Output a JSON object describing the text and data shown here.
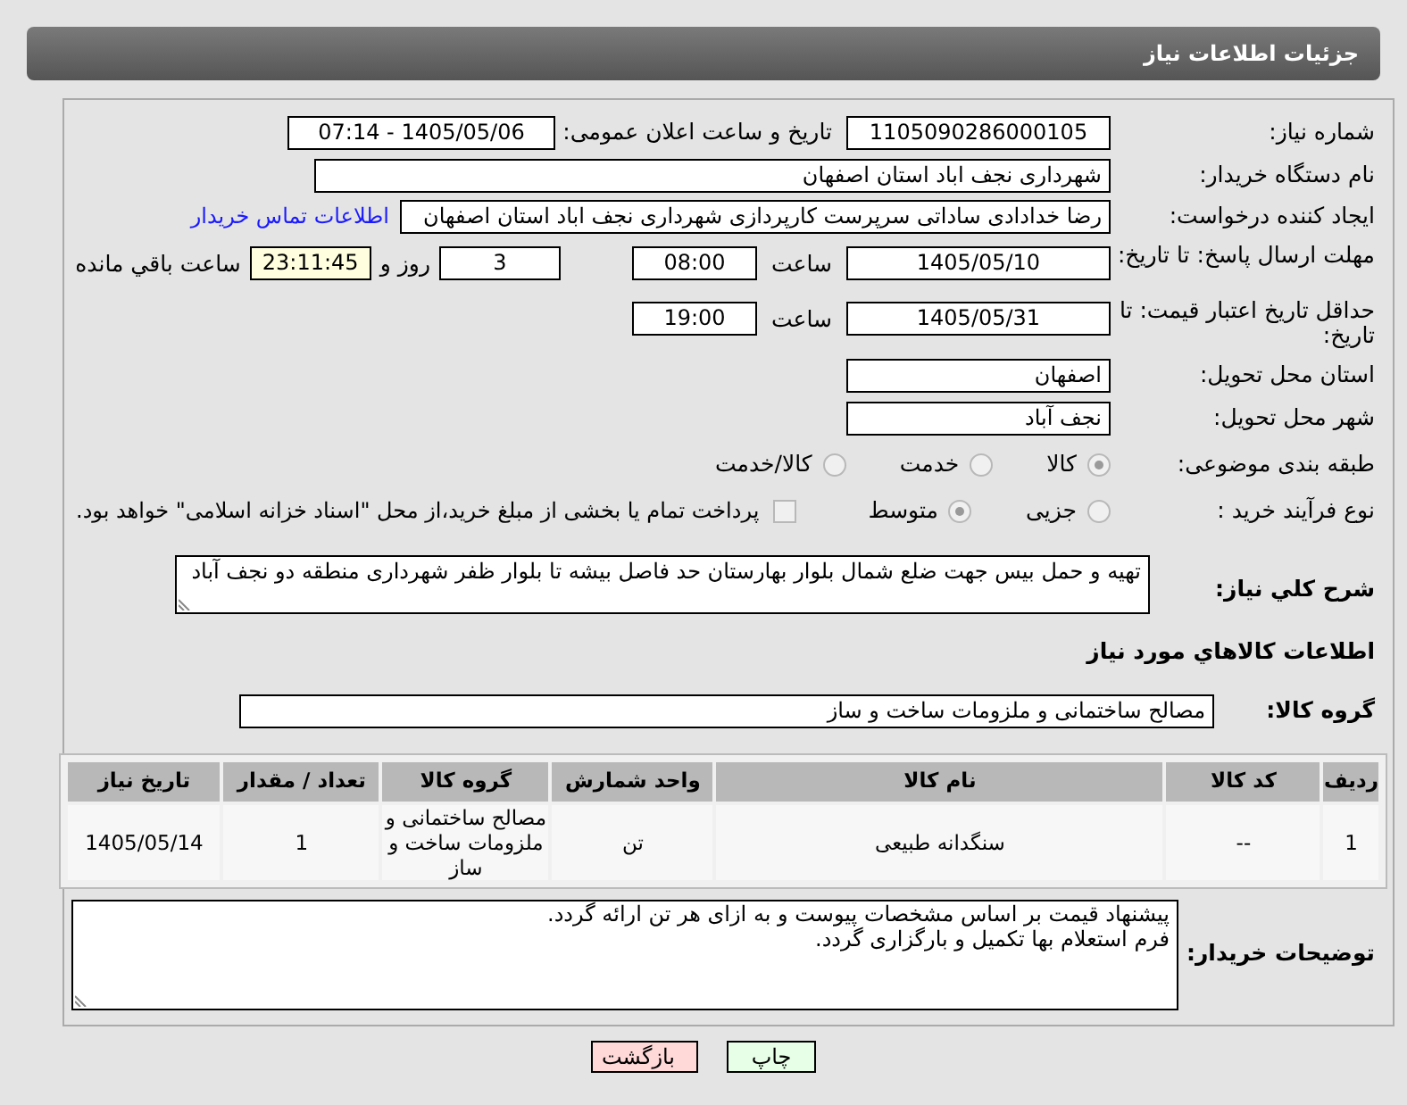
{
  "header": {
    "title": "جزئیات اطلاعات نیاز"
  },
  "need_number": {
    "label": "شماره نیاز:",
    "value": "1105090286000105"
  },
  "announce_datetime": {
    "label": "تاریخ و ساعت اعلان عمومی:",
    "value": "1405/05/06 - 07:14"
  },
  "buyer_org": {
    "label": "نام دستگاه خریدار:",
    "value": "شهرداری نجف اباد استان اصفهان"
  },
  "requester": {
    "label": "ایجاد کننده درخواست:",
    "value": "رضا خدادادی ساداتی سرپرست  کارپردازی شهرداری نجف اباد استان اصفهان",
    "link": "اطلاعات تماس خریدار"
  },
  "reply_deadline": {
    "label": "مهلت ارسال پاسخ: تا تاریخ:",
    "date": "1405/05/10",
    "time_label": "ساعت",
    "time": "08:00",
    "days": "3",
    "days_label": "روز و",
    "remaining": "23:11:45",
    "remaining_label": "ساعت باقي مانده"
  },
  "price_validity": {
    "label": "حداقل تاریخ اعتبار قیمت: تا تاریخ:",
    "date": "1405/05/31",
    "time_label": "ساعت",
    "time": "19:00"
  },
  "delivery_province": {
    "label": "استان محل تحویل:",
    "value": "اصفهان"
  },
  "delivery_city": {
    "label": "شهر محل تحویل:",
    "value": "نجف آباد"
  },
  "category": {
    "label": "طبقه بندی موضوعی:",
    "options": [
      {
        "label": "کالا",
        "selected": true
      },
      {
        "label": "خدمت",
        "selected": false
      },
      {
        "label": "کالا/خدمت",
        "selected": false
      }
    ]
  },
  "process": {
    "label": "نوع فرآیند خرید :",
    "options": [
      {
        "label": "جزیی",
        "selected": false
      },
      {
        "label": "متوسط",
        "selected": true
      }
    ],
    "treasury": {
      "label": "پرداخت تمام یا بخشی از مبلغ خرید،از محل \"اسناد خزانه اسلامی\" خواهد بود.",
      "checked": false
    }
  },
  "description": {
    "label": "شرح کلي نياز:",
    "value": "تهیه و حمل بیس جهت ضلع شمال بلوار بهارستان حد فاصل بیشه تا بلوار ظفر شهرداری منطقه دو نجف آباد"
  },
  "goods_section": {
    "title": "اطلاعات کالاهاي مورد نياز"
  },
  "goods_group": {
    "label": "گروه کالا:",
    "value": "مصالح ساختمانی و ملزومات ساخت و ساز"
  },
  "table": {
    "columns": [
      "ردیف",
      "کد کالا",
      "نام کالا",
      "واحد شمارش",
      "گروه کالا",
      "تعداد / مقدار",
      "تاریخ نیاز"
    ],
    "rows": [
      [
        "1",
        "--",
        "سنگدانه طبیعی",
        "تن",
        "مصالح ساختمانی و ملزومات ساخت و ساز",
        "1",
        "1405/05/14"
      ]
    ]
  },
  "buyer_notes": {
    "label": "توضیحات خریدار:",
    "lines": [
      "پیشنهاد قیمت بر اساس مشخصات پیوست و به ازای هر تن ارائه گردد.",
      "فرم استعلام بها تکمیل و بارگزاری گردد."
    ]
  },
  "buttons": [
    {
      "kind": "print",
      "label": "چاپ"
    },
    {
      "kind": "back",
      "label": "بازگشت"
    }
  ]
}
